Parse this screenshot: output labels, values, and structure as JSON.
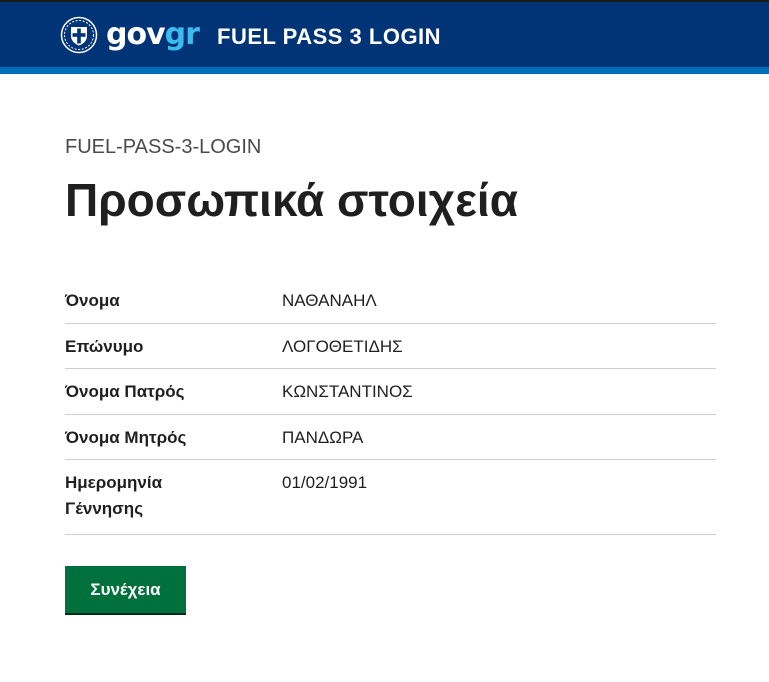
{
  "header": {
    "logo_main": "gov",
    "logo_accent": "gr",
    "app_title": "FUEL PASS 3 LOGIN"
  },
  "colors": {
    "header_bg": "#003476",
    "header_stripe": "#006fb9",
    "logo_accent": "#3dbbf0",
    "button_bg": "#00703c"
  },
  "main": {
    "caption": "FUEL-PASS-3-LOGIN",
    "title": "Προσωπικά στοιχεία",
    "details": [
      {
        "label": "Όνομα",
        "value": "ΝΑΘΑΝΑΗΛ"
      },
      {
        "label": "Επώνυμο",
        "value": "ΛΟΓΟΘΕΤΙΔΗΣ"
      },
      {
        "label": "Όνομα Πατρός",
        "value": "ΚΩΝΣΤΑΝΤΙΝΟΣ"
      },
      {
        "label": "Όνομα Μητρός",
        "value": "ΠΑΝΔΩΡΑ"
      },
      {
        "label": "Ημερομηνία Γέννησης",
        "value": "01/02/1991"
      }
    ],
    "continue_label": "Συνέχεια"
  },
  "icons": {
    "emblem": "greek-coat-of-arms-icon"
  }
}
